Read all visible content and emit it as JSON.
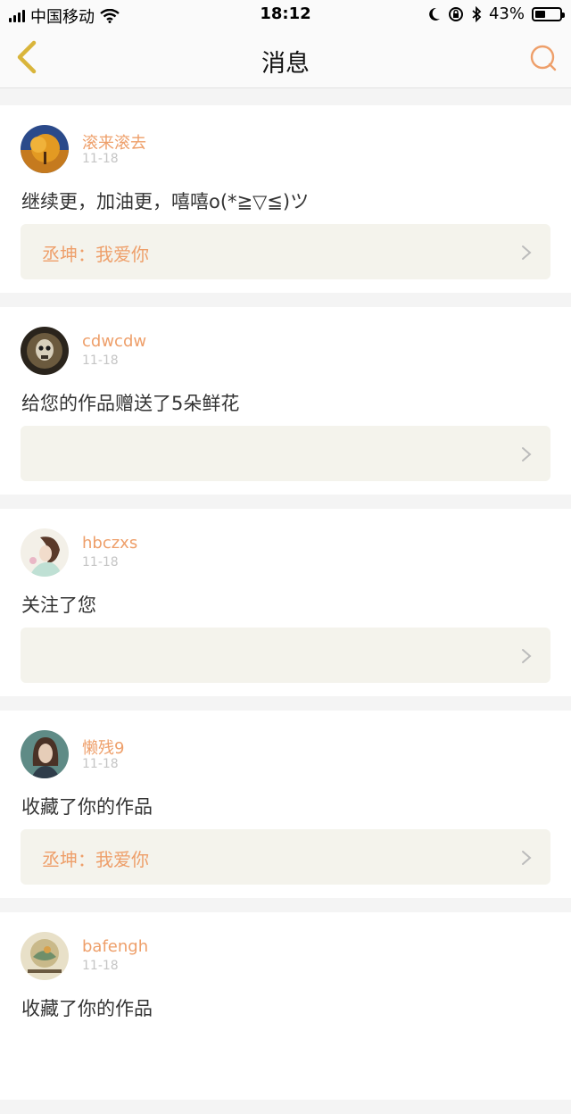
{
  "status_bar": {
    "carrier": "中国移动",
    "time": "18:12",
    "battery_text": "43%",
    "battery_level": 0.43
  },
  "header": {
    "title": "消息",
    "back_icon": "chevron-left-icon",
    "search_icon": "search-icon"
  },
  "colors": {
    "accent": "#ee9f6a",
    "back_icon": "#d9b53b",
    "ref_background": "#f4f3ec"
  },
  "messages": [
    {
      "username": "滚来滚去",
      "date": "11-18",
      "text": "继续更，加油更，嘻嘻o(*≧▽≦)ツ",
      "reference": "丞坤：我爱你",
      "avatar": "autumn-tree"
    },
    {
      "username": "cdwcdw",
      "date": "11-18",
      "text": "给您的作品赠送了5朵鲜花",
      "reference": "",
      "avatar": "skull-art"
    },
    {
      "username": "hbczxs",
      "date": "11-18",
      "text": "关注了您",
      "reference": "",
      "avatar": "girl-sketch"
    },
    {
      "username": "懒残9",
      "date": "11-18",
      "text": "收藏了你的作品",
      "reference": "丞坤：我爱你",
      "avatar": "portrait"
    },
    {
      "username": "bafengh",
      "date": "11-18",
      "text": "收藏了你的作品",
      "reference": "",
      "avatar": "painting"
    }
  ]
}
